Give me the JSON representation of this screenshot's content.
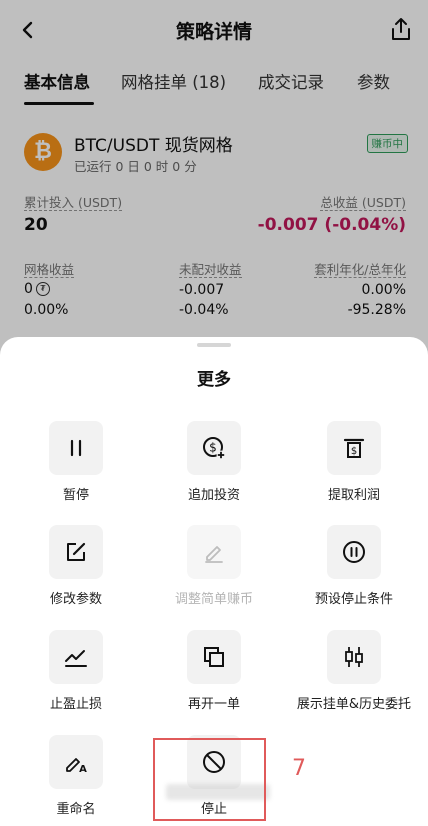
{
  "header": {
    "title": "策略详情"
  },
  "tabs": [
    {
      "label": "基本信息"
    },
    {
      "label": "网格挂单 (18)"
    },
    {
      "label": "成交记录"
    },
    {
      "label": "参数"
    }
  ],
  "strategy": {
    "coin_symbol": "₿",
    "pair": "BTC/USDT 现货网格",
    "runtime": "已运行 0 日 0 时 0 分",
    "badge": "赚币中"
  },
  "stats": {
    "invest_label": "累计投入 (USDT)",
    "invest_value": "20",
    "total_profit_label": "总收益 (USDT)",
    "total_profit_value": "-0.007 (-0.04%)",
    "grid_profit_label": "网格收益",
    "grid_profit_value": "0",
    "grid_profit_pct": "0.00%",
    "unmatched_label": "未配对收益",
    "unmatched_value": "-0.007",
    "unmatched_pct": "-0.04%",
    "apr_label": "套利年化/总年化",
    "apr_value": "0.00%",
    "apr_total": "-95.28%"
  },
  "sheet": {
    "title": "更多",
    "items": [
      {
        "label": "暂停",
        "icon": "pause-icon"
      },
      {
        "label": "追加投资",
        "icon": "add-investment-icon"
      },
      {
        "label": "提取利润",
        "icon": "withdraw-profit-icon"
      },
      {
        "label": "修改参数",
        "icon": "edit-icon"
      },
      {
        "label": "调整简单赚币",
        "icon": "pencil-icon"
      },
      {
        "label": "预设停止条件",
        "icon": "pause-circle-icon"
      },
      {
        "label": "止盈止损",
        "icon": "trend-icon"
      },
      {
        "label": "再开一单",
        "icon": "copy-icon"
      },
      {
        "label": "展示挂单&历史委托",
        "icon": "candlestick-icon"
      },
      {
        "label": "重命名",
        "icon": "rename-icon"
      },
      {
        "label": "停止",
        "icon": "stop-icon"
      }
    ]
  },
  "annotation": {
    "label": "7",
    "color": "#e05a5a"
  },
  "colors": {
    "negative": "#c2185b",
    "badge": "#2e9c5a",
    "coin": "#f7931a"
  }
}
